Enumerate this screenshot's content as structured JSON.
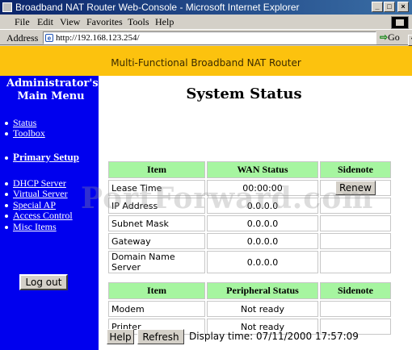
{
  "window": {
    "title": "Broadband NAT Router Web-Console - Microsoft Internet Explorer",
    "controls": [
      "_",
      "□",
      "×"
    ]
  },
  "menubar": {
    "items": [
      {
        "label": "File"
      },
      {
        "label": "Edit"
      },
      {
        "label": "View"
      },
      {
        "label": "Favorites"
      },
      {
        "label": "Tools"
      },
      {
        "label": "Help"
      }
    ]
  },
  "addressbar": {
    "label": "Address",
    "url": "http://192.168.123.254/",
    "go_label": "Go"
  },
  "banner": {
    "text": "Multi-Functional Broadband NAT Router"
  },
  "sidebar": {
    "title": "Administrator's Main Menu",
    "items": [
      {
        "label": "Status"
      },
      {
        "label": "Toolbox"
      },
      {
        "label": "Primary Setup"
      },
      {
        "label": "DHCP Server"
      },
      {
        "label": "Virtual Server"
      },
      {
        "label": "Special AP"
      },
      {
        "label": "Access Control"
      },
      {
        "label": "Misc Items"
      }
    ],
    "logout_label": "Log out"
  },
  "main": {
    "title": "System Status",
    "wan_table": {
      "headers": [
        "Item",
        "WAN Status",
        "Sidenote"
      ],
      "rows": [
        {
          "item": "Lease Time",
          "status": "00:00:00",
          "sidenote_button": "Renew"
        },
        {
          "item": "IP Address",
          "status": "0.0.0.0",
          "sidenote": ""
        },
        {
          "item": "Subnet Mask",
          "status": "0.0.0.0",
          "sidenote": ""
        },
        {
          "item": "Gateway",
          "status": "0.0.0.0",
          "sidenote": ""
        },
        {
          "item": "Domain Name Server",
          "status": "0.0.0.0",
          "sidenote": ""
        }
      ]
    },
    "peripheral_table": {
      "headers": [
        "Item",
        "Peripheral Status",
        "Sidenote"
      ],
      "rows": [
        {
          "item": "Modem",
          "status": "Not ready",
          "sidenote": ""
        },
        {
          "item": "Printer",
          "status": "Not ready",
          "sidenote": ""
        }
      ]
    },
    "help_label": "Help",
    "refresh_label": "Refresh",
    "display_time": "Display time: 07/11/2000 17:57:09"
  },
  "watermark": "PortForward.com",
  "colors": {
    "banner": "#fcc20e",
    "sidebar": "#0000ee",
    "table_header": "#a6f5a0"
  }
}
